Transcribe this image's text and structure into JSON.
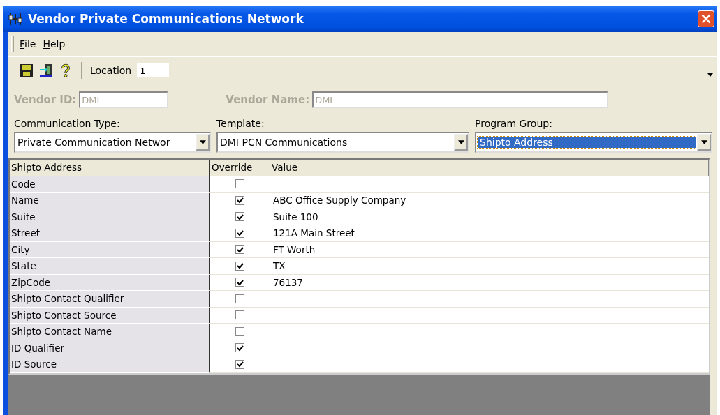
{
  "window": {
    "title": "Vendor Private Communications Network"
  },
  "menu": [
    {
      "label": "File"
    },
    {
      "label": "Help"
    }
  ],
  "toolbar": {
    "location_label": "Location",
    "location_value": "1"
  },
  "vendor": {
    "id_label": "Vendor ID:",
    "id_value": "DMI",
    "name_label": "Vendor Name:",
    "name_value": "DMI",
    "disabled": true
  },
  "selectors": [
    {
      "label": "Communication Type:",
      "value": "Private Communication Networ",
      "focused": false
    },
    {
      "label": "Template:",
      "value": "DMI PCN Communications",
      "focused": false
    },
    {
      "label": "Program Group:",
      "value": "Shipto Address",
      "focused": true
    }
  ],
  "table": {
    "columns": [
      "Shipto Address",
      "Override",
      "Value"
    ],
    "rows": [
      {
        "field": "Code",
        "override": false
      },
      {
        "field": "Name",
        "override": true,
        "value": "ABC Office Supply Company"
      },
      {
        "field": "Suite",
        "override": true,
        "value": "Suite 100"
      },
      {
        "field": "Street",
        "override": true,
        "value": "121A Main Street"
      },
      {
        "field": "City",
        "override": true,
        "value": "FT Worth"
      },
      {
        "field": "State",
        "override": true,
        "value": "TX"
      },
      {
        "field": "ZipCode",
        "override": true,
        "value": "76137"
      },
      {
        "field": "Shipto Contact Qualifier",
        "override": false
      },
      {
        "field": "Shipto Contact Source",
        "override": false
      },
      {
        "field": "Shipto Contact Name",
        "override": false
      },
      {
        "field": "ID Qualifier",
        "override": true
      },
      {
        "field": "ID Source",
        "override": true
      }
    ]
  }
}
